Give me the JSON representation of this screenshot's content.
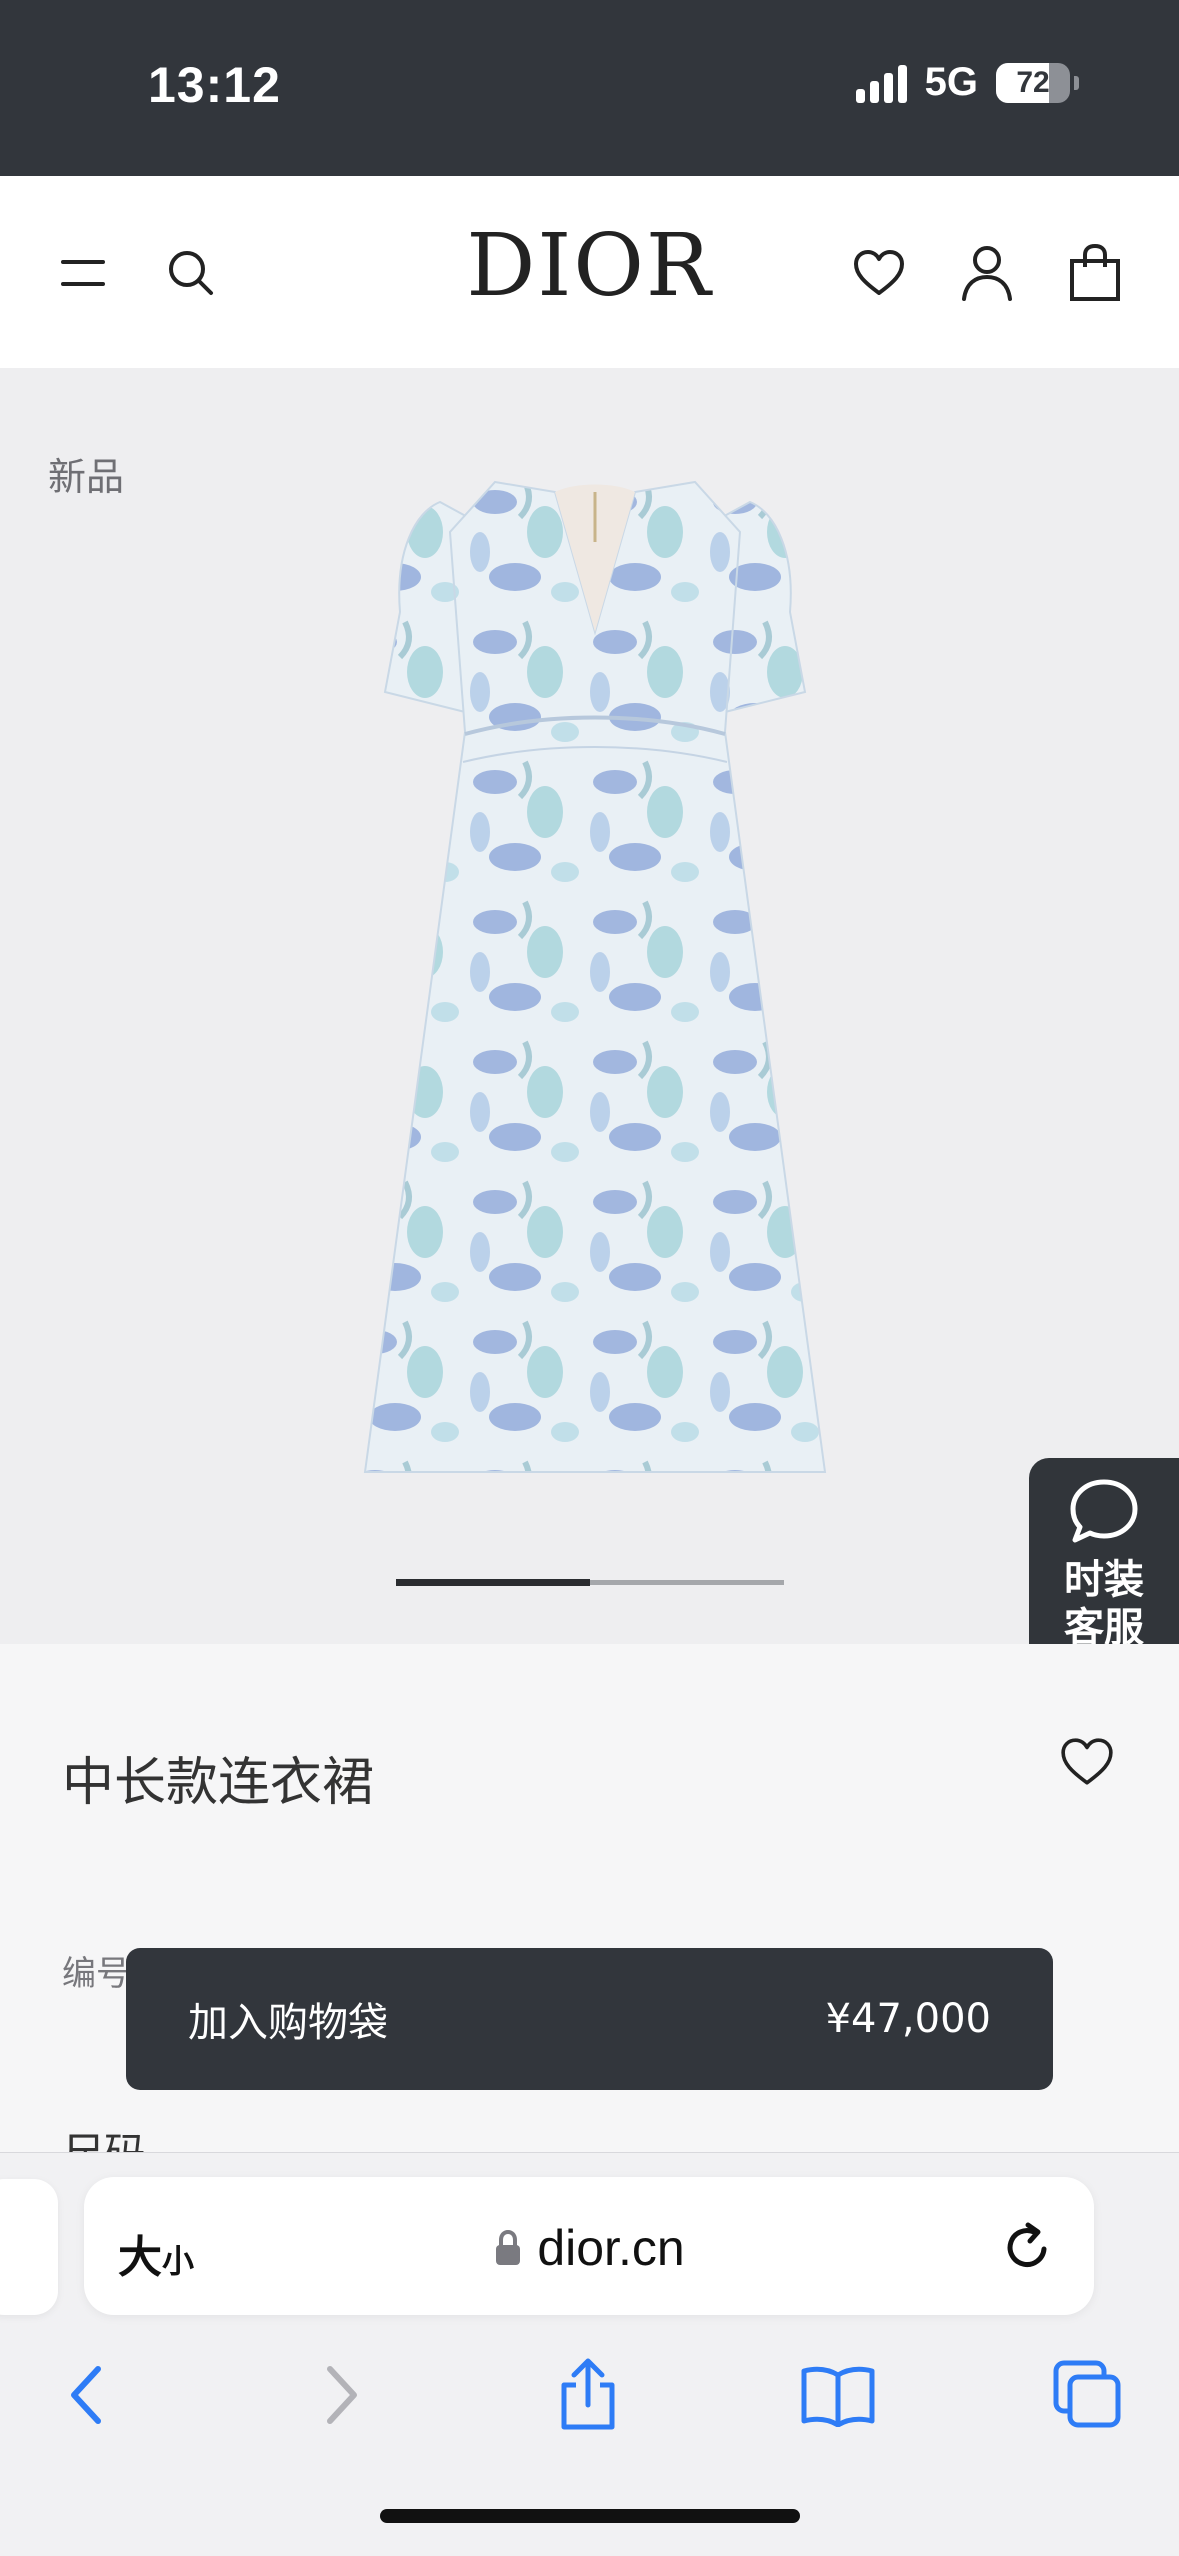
{
  "status_bar": {
    "time": "13:12",
    "network": "5G",
    "battery": "72",
    "battery_level": 0.72
  },
  "header": {
    "logo": "DIOR",
    "icons": [
      "menu-icon",
      "search-icon",
      "heart-icon",
      "user-icon",
      "shopping-bag-icon"
    ]
  },
  "product": {
    "badge": "新品",
    "name": "中长款连衣裙",
    "ref_label": "编号",
    "size_label": "尺码",
    "image_index": 1,
    "image_count": 2,
    "carousel_progress": 0.5
  },
  "chat": {
    "label_line1": "时装",
    "label_line2": "客服",
    "icon": "chat-bubble-icon"
  },
  "cart_bar": {
    "label": "加入购物袋",
    "price": "¥47,000"
  },
  "browser": {
    "text_size_big": "大",
    "text_size_small": "小",
    "url": "dior.cn",
    "icons": [
      "lock-icon",
      "reload-icon",
      "back-icon",
      "forward-icon",
      "share-icon",
      "bookmarks-icon",
      "tabs-icon"
    ]
  },
  "colors": {
    "status_bar_bg": "#32363c",
    "product_bg": "#eeeef0",
    "safari_blue": "#2e7cf6",
    "dress_blue": "#8aa4d8"
  }
}
